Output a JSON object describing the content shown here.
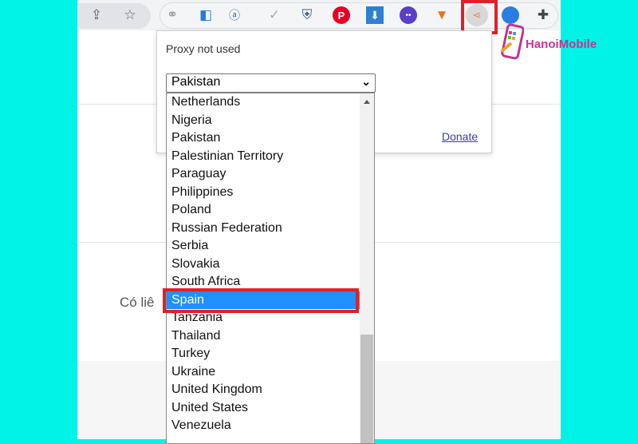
{
  "toolbar": {
    "icons": [
      "share-icon",
      "star-icon",
      "link-icon",
      "tag-icon",
      "stamp-icon",
      "check-icon",
      "shield-icon",
      "pinterest-icon",
      "download-icon",
      "chat-icon",
      "fox-icon",
      "proxy-icon",
      "globe-icon",
      "puzzle-icon"
    ]
  },
  "page": {
    "partial_text": "Có liê"
  },
  "popup": {
    "status": "Proxy not used",
    "selected_country": "Pakistan",
    "donate_label": "Donate"
  },
  "dropdown": {
    "options": [
      "Netherlands",
      "Nigeria",
      "Pakistan",
      "Palestinian Territory",
      "Paraguay",
      "Philippines",
      "Poland",
      "Russian Federation",
      "Serbia",
      "Slovakia",
      "South Africa",
      "Spain",
      "Tanzania",
      "Thailand",
      "Turkey",
      "Ukraine",
      "United Kingdom",
      "United States",
      "Venezuela"
    ],
    "highlighted": "Spain"
  },
  "watermark": {
    "text": "HanoiMobile"
  },
  "colors": {
    "highlight": "#1e90ff",
    "annotation": "#e0202a",
    "background": "#00f3e6"
  }
}
